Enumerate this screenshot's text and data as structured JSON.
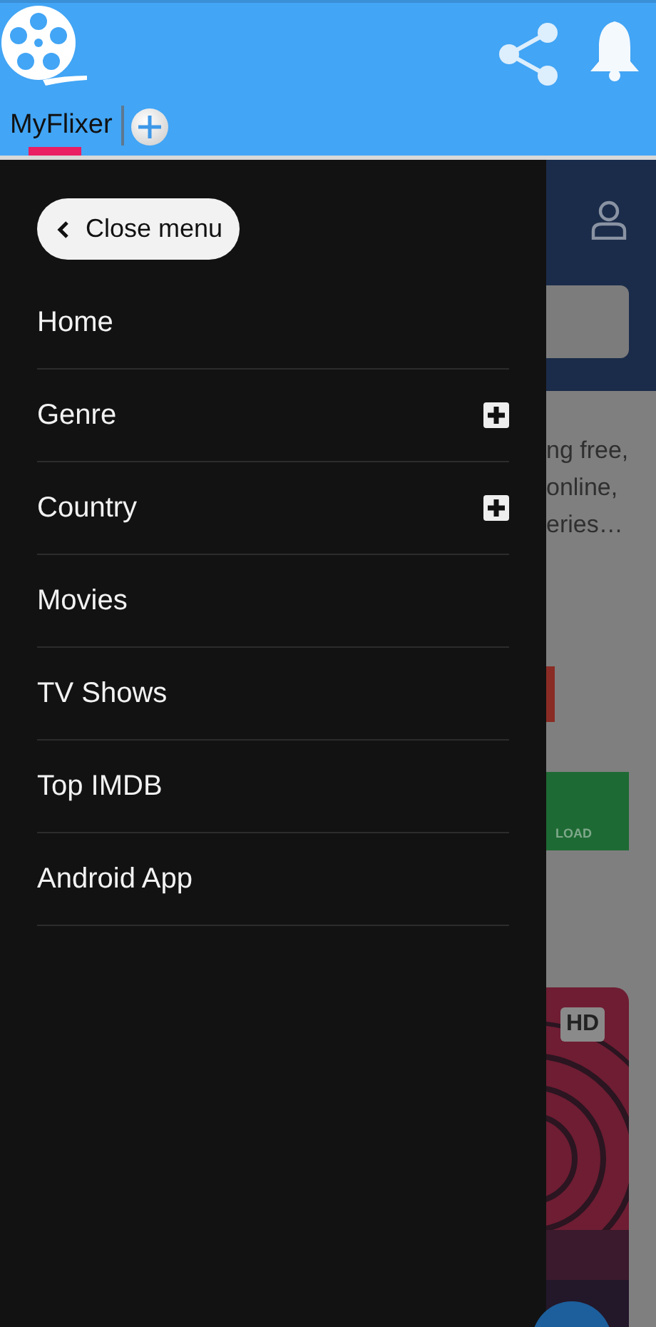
{
  "tabs": [
    {
      "label": "MyFlixer",
      "selected": true
    }
  ],
  "drawer": {
    "close_button": "Close menu",
    "items": [
      {
        "label": "Home",
        "expandable": false
      },
      {
        "label": "Genre",
        "expandable": true
      },
      {
        "label": "Country",
        "expandable": true
      },
      {
        "label": "Movies",
        "expandable": false
      },
      {
        "label": "TV Shows",
        "expandable": false
      },
      {
        "label": "Top IMDB",
        "expandable": false
      },
      {
        "label": "Android App",
        "expandable": false
      }
    ]
  },
  "page": {
    "description_lines": [
      "ng free,",
      "online,",
      "eries…"
    ],
    "download_button": "LOAD",
    "card": {
      "badge": "HD",
      "kind": "picture"
    }
  }
}
